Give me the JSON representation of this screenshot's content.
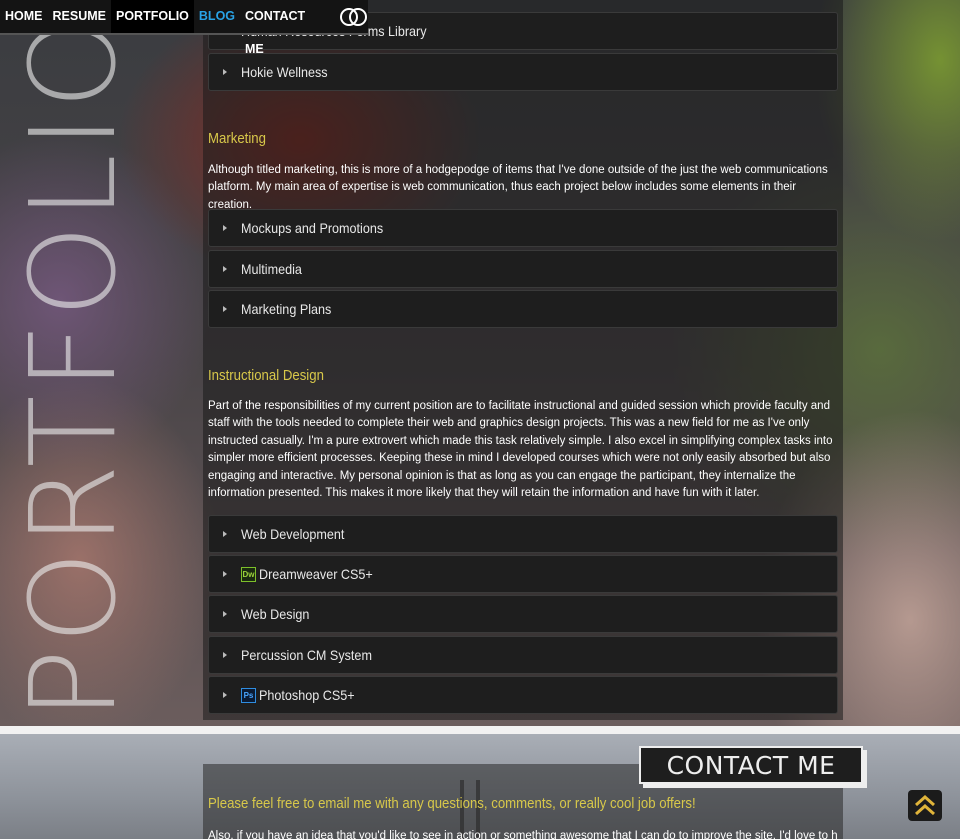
{
  "nav": {
    "items": [
      {
        "label": "HOME"
      },
      {
        "label": "RESUME"
      },
      {
        "label": "PORTFOLIO"
      },
      {
        "label": "BLOG"
      },
      {
        "label": "CONTACT ME"
      }
    ],
    "logo_icon": "double-ring-logo-icon"
  },
  "side_title": "PORTFOLIO",
  "hr_section": {
    "items": [
      {
        "label": "Human Resources Forms Library"
      },
      {
        "label": "Hokie Wellness"
      }
    ]
  },
  "marketing": {
    "title": "Marketing",
    "description": "Although titled marketing, this is more of a hodgepodge of items that I've done outside of the just the web communications platform. My main area of expertise is web communication, thus each project below includes some elements in their creation.",
    "items": [
      {
        "label": "Mockups and Promotions"
      },
      {
        "label": "Multimedia"
      },
      {
        "label": "Marketing Plans"
      }
    ]
  },
  "instructional": {
    "title": "Instructional Design",
    "description": "Part of the responsibilities of my current position are to facilitate instructional and guided session which provide faculty and staff with the tools needed to complete their web and graphics design projects. This was a new field for me as I've only instructed casually. I'm a pure extrovert which made this task relatively simple. I also excel in simplifying complex tasks into simpler more efficient processes. Keeping these in mind I developed courses which were not only easily absorbed but also engaging and interactive. My personal opinion is that as long as you can engage the participant, they internalize the information presented. This makes it more likely that they will retain the information and have fun with it later.",
    "items": [
      {
        "label": "Web Development"
      },
      {
        "label": "Dreamweaver CS5+",
        "icon_text": "Dw"
      },
      {
        "label": "Web Design"
      },
      {
        "label": "Percussion CM System"
      },
      {
        "label": "Photoshop CS5+",
        "icon_text": "Ps"
      }
    ]
  },
  "contact": {
    "badge": "CONTACT ME",
    "heading": "Please feel free to email me with any questions, comments, or really cool job offers!",
    "text": "Also, if you have an idea that you'd like to see in action or something awesome that I can do to improve the site, I'd love to hear"
  },
  "colors": {
    "accent_yellow": "#d8c84a",
    "blog_blue": "#29a3e6",
    "accordion_bg": "#1e1e1e"
  },
  "scroll_top_icon": "double-chevron-up-icon"
}
